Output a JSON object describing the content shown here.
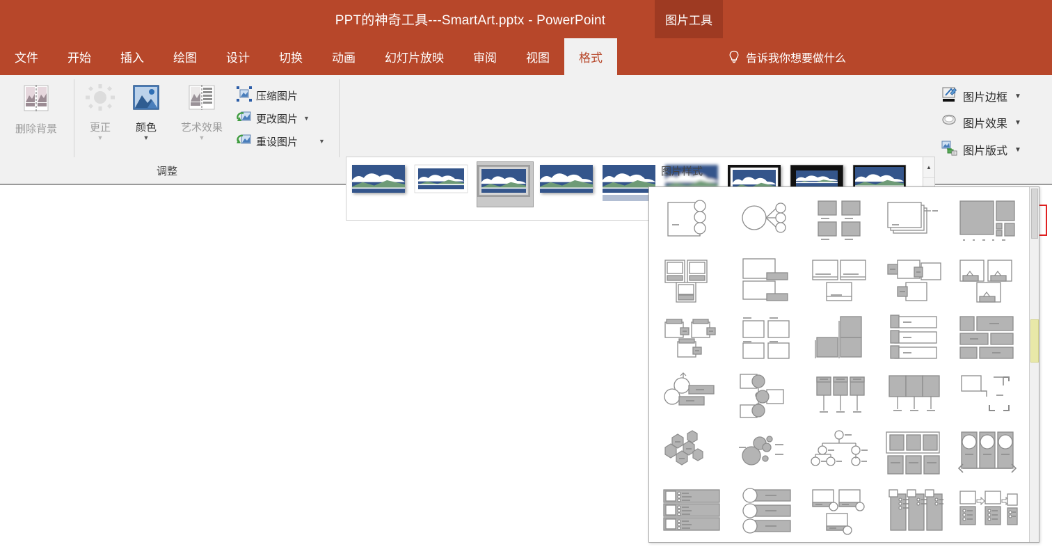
{
  "window": {
    "title": "PPT的神奇工具---SmartArt.pptx  -  PowerPoint",
    "contextual_tab_label": "图片工具",
    "titlebar_color": "#b7472a",
    "contextual_color": "#9e3a22"
  },
  "tabs": [
    {
      "label": "文件",
      "active": false
    },
    {
      "label": "开始",
      "active": false
    },
    {
      "label": "插入",
      "active": false
    },
    {
      "label": "绘图",
      "active": false
    },
    {
      "label": "设计",
      "active": false
    },
    {
      "label": "切换",
      "active": false
    },
    {
      "label": "动画",
      "active": false
    },
    {
      "label": "幻灯片放映",
      "active": false
    },
    {
      "label": "审阅",
      "active": false
    },
    {
      "label": "视图",
      "active": false
    },
    {
      "label": "格式",
      "active": true
    }
  ],
  "tell_me": {
    "label": "告诉我你想要做什么",
    "icon": "lightbulb-icon"
  },
  "ribbon": {
    "groups": [
      {
        "name": "adjust",
        "label": "调整"
      },
      {
        "name": "picture-styles",
        "label": "图片样式"
      }
    ],
    "adjust": {
      "big_buttons": [
        {
          "label": "删除背景",
          "icon": "remove-background-icon",
          "disabled": true,
          "has_caret": false
        },
        {
          "label": "更正",
          "icon": "corrections-icon",
          "disabled": true,
          "has_caret": true
        },
        {
          "label": "颜色",
          "icon": "color-icon",
          "disabled": false,
          "has_caret": true
        },
        {
          "label": "艺术效果",
          "icon": "artistic-effects-icon",
          "disabled": true,
          "has_caret": true
        }
      ],
      "small_buttons": [
        {
          "label": "压缩图片",
          "icon": "compress-picture-icon",
          "has_caret": false
        },
        {
          "label": "更改图片",
          "icon": "change-picture-icon",
          "has_caret": true
        },
        {
          "label": "重设图片",
          "icon": "reset-picture-icon",
          "has_caret": true
        }
      ]
    },
    "picture_styles": {
      "thumbnails": [
        {
          "name": "simple-frame-white",
          "selected": false
        },
        {
          "name": "beveled-matte-white",
          "selected": false
        },
        {
          "name": "metal-frame",
          "selected": true
        },
        {
          "name": "drop-shadow-rectangle",
          "selected": false
        },
        {
          "name": "reflected-rounded-rectangle",
          "selected": false
        },
        {
          "name": "soft-edge-rectangle",
          "selected": false
        },
        {
          "name": "double-frame-black",
          "selected": false
        },
        {
          "name": "thick-matte-black",
          "selected": false
        },
        {
          "name": "simple-frame-black",
          "selected": false
        }
      ],
      "scroll_buttons": [
        "up",
        "down",
        "more"
      ]
    },
    "right_buttons": [
      {
        "label": "图片边框",
        "icon": "picture-border-icon",
        "has_caret": true,
        "highlighted": false
      },
      {
        "label": "图片效果",
        "icon": "picture-effects-icon",
        "has_caret": true,
        "highlighted": false
      },
      {
        "label": "图片版式",
        "icon": "picture-layout-icon",
        "has_caret": true,
        "highlighted": true
      }
    ],
    "dialog_launcher": {
      "icon": "dialog-launcher-icon"
    }
  },
  "picture_layout_dropdown": {
    "open": true,
    "columns": 5,
    "rows": 6,
    "items": [
      {
        "name": "accented-picture"
      },
      {
        "name": "bending-picture-caption"
      },
      {
        "name": "bubble-picture-list"
      },
      {
        "name": "captioned-pictures"
      },
      {
        "name": "circular-picture-callout"
      },
      {
        "name": "continuous-picture-list"
      },
      {
        "name": "framed-text-picture"
      },
      {
        "name": "hexagon-cluster"
      },
      {
        "name": "picture-accent-blocks"
      },
      {
        "name": "picture-accent-list"
      },
      {
        "name": "picture-accent-process"
      },
      {
        "name": "picture-caption-list"
      },
      {
        "name": "picture-grid"
      },
      {
        "name": "picture-lineup"
      },
      {
        "name": "picture-organization-chart"
      },
      {
        "name": "picture-strips"
      },
      {
        "name": "radial-picture-list"
      },
      {
        "name": "snapshot-picture-list"
      },
      {
        "name": "spiral-picture"
      },
      {
        "name": "staggered-process"
      },
      {
        "name": "theme-picture-accent"
      },
      {
        "name": "theme-picture-alternating"
      },
      {
        "name": "theme-picture-grid"
      },
      {
        "name": "titled-picture-accent-list"
      },
      {
        "name": "titled-picture-blocks"
      },
      {
        "name": "titled-picture-lineup"
      },
      {
        "name": "vertical-picture-accent-list"
      },
      {
        "name": "vertical-picture-list"
      },
      {
        "name": "alternating-picture-blocks"
      },
      {
        "name": "bending-picture-semi-transparent"
      }
    ]
  }
}
